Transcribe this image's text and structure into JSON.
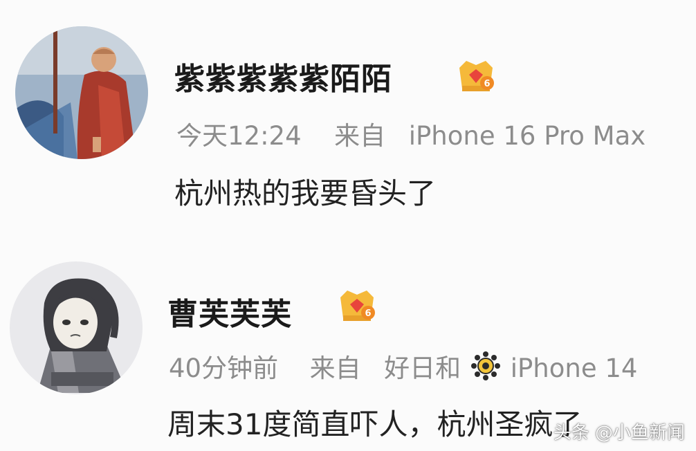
{
  "comments": [
    {
      "username": "紫紫紫紫紫陌陌",
      "level": "6",
      "time": "今天12:24",
      "source_prefix": "来自",
      "source_device": "iPhone 16 Pro Max",
      "text": "杭州热的我要昏头了"
    },
    {
      "username": "曹芙芙芙",
      "level": "6",
      "time": "40分钟前",
      "source_prefix": "来自",
      "source_name": "好日和",
      "source_device": "iPhone 14",
      "text": "周末31度简直吓人，杭州圣疯了"
    }
  ],
  "watermark": "头条 @小鱼新闻",
  "icons": {
    "crown": "crown-badge-icon",
    "sun": "sun-flower-icon"
  },
  "colors": {
    "background": "#fbfbfb",
    "meta": "#8c8c8c",
    "crown_gold": "#f5b93a",
    "crown_red": "#e8453c"
  }
}
